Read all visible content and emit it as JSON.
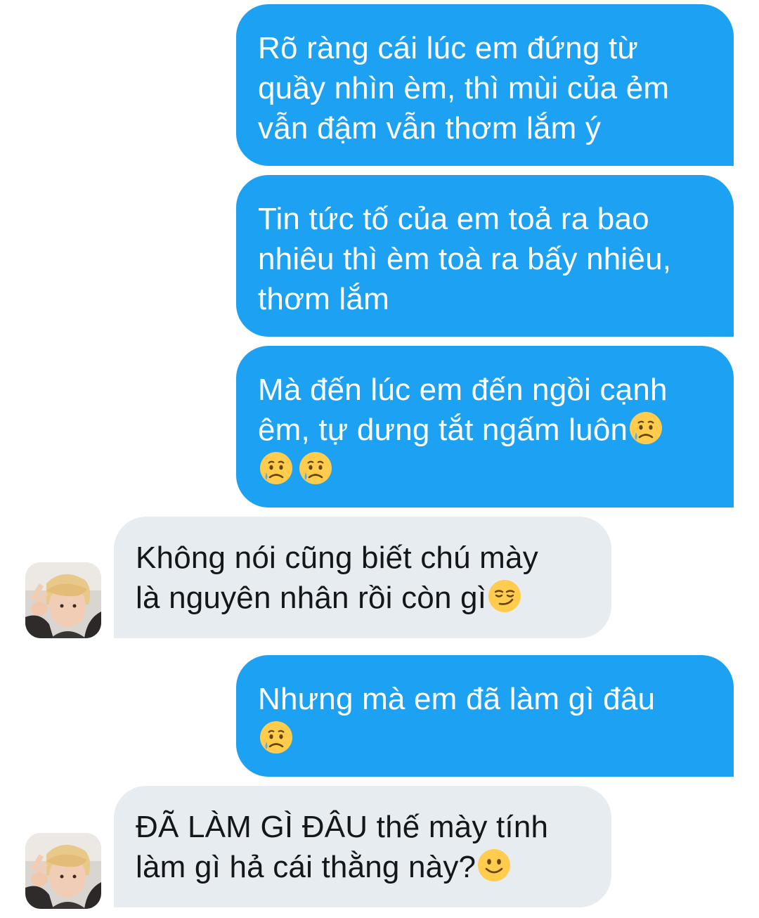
{
  "conversation": {
    "messages": [
      {
        "direction": "sent",
        "lines": [
          "Rõ ràng cái lúc em đứng từ",
          "quầy nhìn èm, thì mùi của ẻm",
          "vẫn đậm vẫn thơm lắm ý"
        ]
      },
      {
        "direction": "sent",
        "lines": [
          "Tin tức tố của em toả ra bao",
          "nhiêu thì èm toà ra bấy nhiêu,",
          "thơm lắm"
        ]
      },
      {
        "direction": "sent",
        "lines": [
          "Mà đến lúc em đến ngồi cạnh",
          "êm, tự dưng tắt ngấm luôn"
        ],
        "emoji": [
          "crying-face",
          "crying-face",
          "crying-face"
        ]
      },
      {
        "direction": "received",
        "lines": [
          "Không nói cũng biết chú mày",
          "là nguyên nhân rồi còn gì"
        ],
        "emoji": [
          "smirking-face"
        ]
      },
      {
        "direction": "sent",
        "lines": [
          "Nhưng mà em đã làm gì đâu"
        ],
        "emoji": [
          "crying-face"
        ]
      },
      {
        "direction": "received",
        "lines": [
          "ĐÃ LÀM GÌ ĐÂU thế mày tính",
          "làm gì hả cái thằng này?"
        ],
        "emoji": [
          "slightly-smiling-face"
        ]
      }
    ]
  },
  "colors": {
    "sent_bubble": "#1da1f2",
    "received_bubble": "#e6ecf0",
    "sent_text": "#ffffff",
    "received_text": "#14171a"
  }
}
